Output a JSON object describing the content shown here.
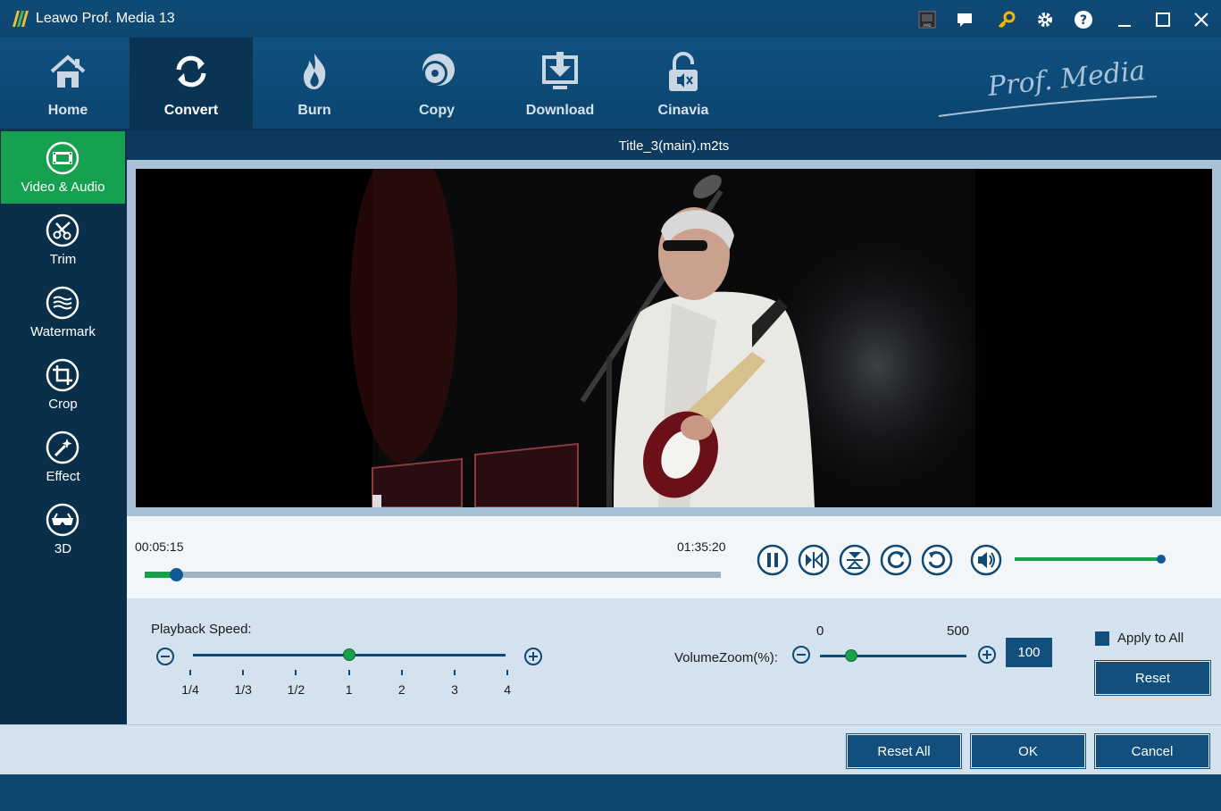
{
  "window": {
    "title": "Leawo Prof. Media 13"
  },
  "titlebar_icons": [
    "amd-badge-icon",
    "feedback-icon",
    "key-icon",
    "gear-icon",
    "help-icon",
    "minimize-icon",
    "maximize-icon",
    "close-icon"
  ],
  "nav": {
    "items": [
      {
        "label": "Home",
        "icon": "home-icon"
      },
      {
        "label": "Convert",
        "icon": "convert-icon",
        "active": true
      },
      {
        "label": "Burn",
        "icon": "burn-icon"
      },
      {
        "label": "Copy",
        "icon": "copy-icon"
      },
      {
        "label": "Download",
        "icon": "download-icon"
      },
      {
        "label": "Cinavia",
        "icon": "cinavia-icon"
      }
    ],
    "brand": "Prof. Media"
  },
  "sidebar": {
    "items": [
      {
        "label": "Video & Audio",
        "icon": "film-icon",
        "active": true
      },
      {
        "label": "Trim",
        "icon": "scissors-icon"
      },
      {
        "label": "Watermark",
        "icon": "watermark-icon"
      },
      {
        "label": "Crop",
        "icon": "crop-icon"
      },
      {
        "label": "Effect",
        "icon": "magic-wand-icon"
      },
      {
        "label": "3D",
        "icon": "3d-glasses-icon"
      }
    ]
  },
  "player": {
    "filename": "Title_3(main).m2ts",
    "current_time": "00:05:15",
    "total_time": "01:35:20",
    "progress_fraction": 0.055,
    "volume_fraction": 1.0,
    "controls": [
      "pause-icon",
      "step-frame-icon",
      "flip-vertical-icon",
      "rotate-clockwise-icon",
      "rotate-counterclockwise-icon",
      "volume-icon"
    ]
  },
  "settings": {
    "playback_speed_label": "Playback Speed:",
    "speed_ticks": [
      "1/4",
      "1/3",
      "1/2",
      "1",
      "2",
      "3",
      "4"
    ],
    "speed_selected": "1",
    "volume_zoom_label": "VolumeZoom(%):",
    "volume_zoom_min": "0",
    "volume_zoom_max": "500",
    "volume_zoom_value": "100",
    "apply_to_all_label": "Apply to All",
    "reset_label": "Reset"
  },
  "footer": {
    "reset_all_label": "Reset All",
    "ok_label": "OK",
    "cancel_label": "Cancel"
  },
  "colors": {
    "accent_green": "#16a150",
    "navy": "#0e4670",
    "button_blue": "#134f7d"
  }
}
